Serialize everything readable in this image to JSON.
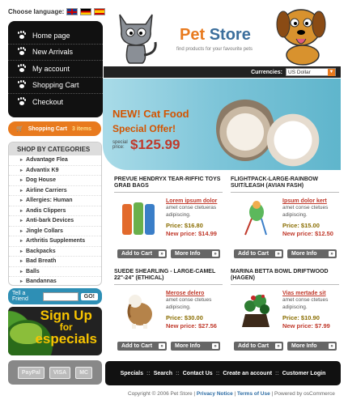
{
  "language": {
    "label": "Choose language:",
    "flags": [
      "english",
      "german",
      "spanish"
    ]
  },
  "nav": [
    {
      "label": "Home page"
    },
    {
      "label": "New Arrivals"
    },
    {
      "label": "My account"
    },
    {
      "label": "Shopping Cart"
    },
    {
      "label": "Checkout"
    }
  ],
  "cart": {
    "label": "Shopping Cart",
    "items": "3 items"
  },
  "categories": {
    "title": "SHOP BY CATEGORIES",
    "items": [
      "Advantage Flea",
      "Advantix K9",
      "Dog House",
      "Airline Carriers",
      "Allergies: Human",
      "Andis Clippers",
      "Anti-bark Devices",
      "Jingle Collars",
      "Arthritis Supplements",
      "Backpacks",
      "Bad Breath",
      "Balls",
      "Bandannas"
    ]
  },
  "tell_friend": {
    "label": "Tell a Friend",
    "go": "GO!"
  },
  "signup": {
    "line1": "Sign Up",
    "line2": "for",
    "line3": "especials"
  },
  "payment": [
    "PayPal",
    "VISA",
    "MC"
  ],
  "header": {
    "logo_a": "Pet ",
    "logo_b": "Store",
    "tagline": "find products for your favourite pets"
  },
  "currencies": {
    "label": "Currencies:",
    "value": "US Dollar"
  },
  "banner": {
    "new": "NEW!",
    "product": "Cat Food",
    "offer": "Special Offer!",
    "special_label": "special price:",
    "price": "$125.99"
  },
  "buttons": {
    "add": "Add to Cart",
    "more": "More Info"
  },
  "products": [
    {
      "title": "PREVUE HENDRYX TEAR-RIFFIC TOYS GRAB BAGS",
      "link": "Lorem ipsum dolor",
      "desc": "amet conse ctetueras adipiscing.",
      "price": "Price: $16.80",
      "new_price": "New price: $14.99"
    },
    {
      "title": "FLIGHTPACK-LARGE-RAINBOW SUIT/LEASH (AVIAN FASH)",
      "link": "Ipsum dolor kert",
      "desc": "amet conse ctetues adipiscing.",
      "price": "Price: $15.00",
      "new_price": "New price: $12.50"
    },
    {
      "title": "SUEDE SHEARLING - LARGE-CAMEL 22\"-24\" (ETHICAL)",
      "link": "Merose delero",
      "desc": "amet conse ctetues adipiscing.",
      "price": "Price: $30.00",
      "new_price": "New price: $27.56"
    },
    {
      "title": "MARINA BETTA BOWL DRIFTWOOD (HAGEN)",
      "link": "Vias mertade sit",
      "desc": "amet conse ctetues adipiscing.",
      "price": "Price: $10.90",
      "new_price": "New price: $7.99"
    }
  ],
  "footer": {
    "links": [
      "Specials",
      "Search",
      "Contact Us",
      "Create an account",
      "Customer Login"
    ],
    "copyright": "Copyright © 2006 Pet Store",
    "privacy": "Privacy Notice",
    "terms": "Terms of Use",
    "powered": "Powered by osCommerce"
  }
}
